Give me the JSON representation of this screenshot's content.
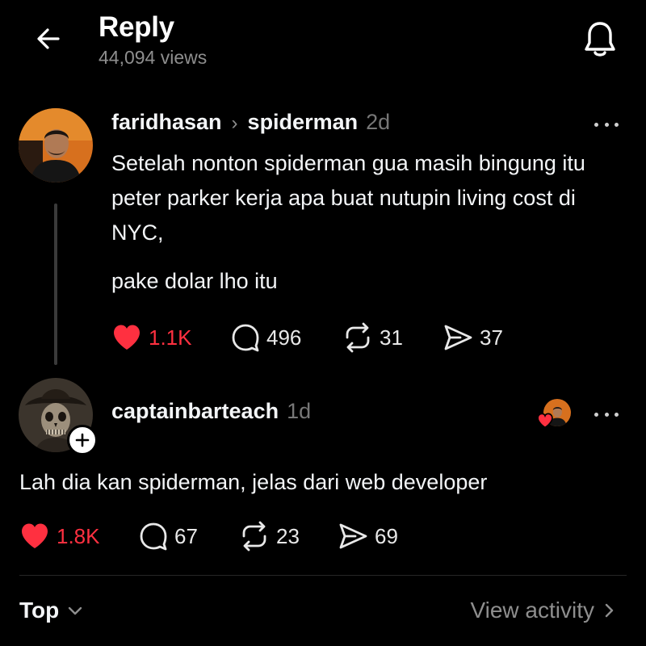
{
  "header": {
    "title": "Reply",
    "views": "44,094 views"
  },
  "parent_post": {
    "username": "faridhasan",
    "replying_to": "spiderman",
    "time": "2d",
    "text_line1": "Setelah nonton spiderman gua masih bingung itu peter parker kerja apa buat nutupin living cost di NYC,",
    "text_line2": "pake dolar lho itu",
    "likes": "1.1K",
    "comments": "496",
    "reposts": "31",
    "shares": "37",
    "liked": true
  },
  "reply_post": {
    "username": "captainbarteach",
    "time": "1d",
    "text": "Lah dia kan spiderman, jelas dari web developer",
    "likes": "1.8K",
    "comments": "67",
    "reposts": "23",
    "shares": "69",
    "liked": true
  },
  "footer": {
    "sort_label": "Top",
    "activity_label": "View activity"
  },
  "icons": {
    "back": "back-arrow-icon",
    "bell": "notification-bell-icon",
    "more": "more-dots-icon",
    "like": "heart-icon",
    "comment": "comment-bubble-icon",
    "repost": "repost-icon",
    "share": "send-icon",
    "follow": "plus-icon"
  },
  "colors": {
    "background": "#000000",
    "like_red": "#ff3040",
    "secondary_text": "#8e8e8e"
  }
}
